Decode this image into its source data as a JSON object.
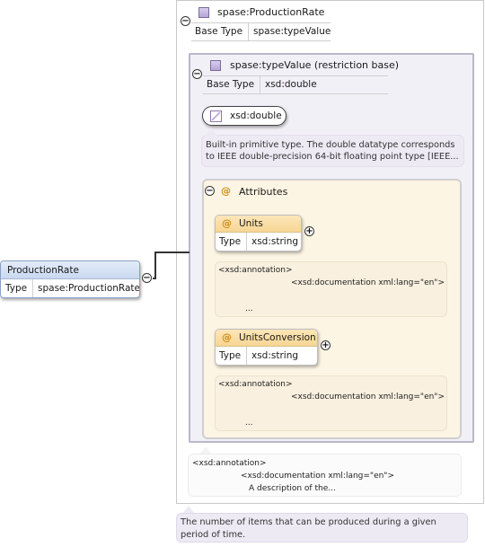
{
  "root_type": {
    "name": "spase:ProductionRate",
    "base_type_label": "Base Type",
    "base_type_value": "spase:typeValue"
  },
  "restriction": {
    "name": "spase:typeValue (restriction base)",
    "base_type_label": "Base Type",
    "base_type_value": "xsd:double",
    "simple_type": "xsd:double",
    "description": "Built-in primitive type. The double datatype corresponds to IEEE double-precision 64-bit floating point type [IEEE..."
  },
  "attributes": {
    "title": "Attributes",
    "items": [
      {
        "name": "Units",
        "type_label": "Type",
        "type_value": "xsd:string",
        "annotation_line1": "<xsd:annotation>",
        "annotation_line2": "<xsd:documentation xml:lang=\"en\">",
        "annotation_line3": "..."
      },
      {
        "name": "UnitsConversion",
        "type_label": "Type",
        "type_value": "xsd:string",
        "annotation_line1": "<xsd:annotation>",
        "annotation_line2": "<xsd:documentation xml:lang=\"en\">",
        "annotation_line3": "..."
      }
    ]
  },
  "element": {
    "name": "ProductionRate",
    "type_label": "Type",
    "type_value": "spase:ProductionRate"
  },
  "element_annotation": {
    "line1": "<xsd:annotation>",
    "line2": "<xsd:documentation xml:lang=\"en\">",
    "line3": "A description of the..."
  },
  "element_description": "The number of items that can be produced during a given period of time.",
  "symbols": {
    "collapse": "−",
    "expand": "+",
    "attribute": "@"
  }
}
